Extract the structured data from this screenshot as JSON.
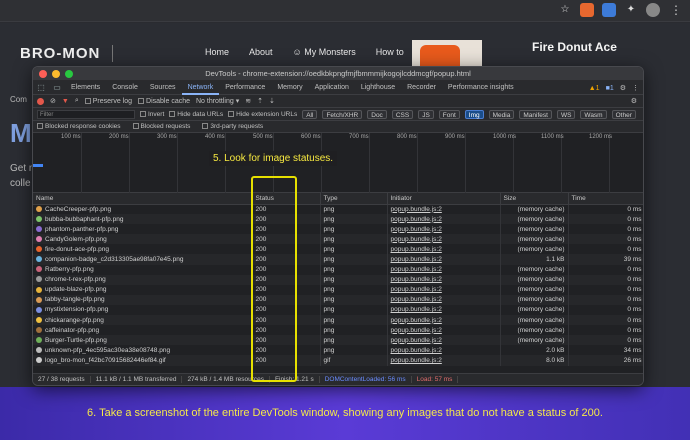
{
  "site": {
    "logo": "BRO-MON",
    "nav": [
      "Home",
      "About",
      "My Monsters",
      "How to"
    ],
    "side_lines": [
      "Com",
      "M",
      "Get r",
      "colle"
    ],
    "card_title": "Fire Donut Ace"
  },
  "devtools": {
    "title": "DevTools - chrome-extension://oedkbkpngfmjfbmmmijkogojlcddmcgf/popup.html",
    "tabs": [
      "Elements",
      "Console",
      "Sources",
      "Network",
      "Performance",
      "Memory",
      "Application",
      "Lighthouse",
      "Recorder",
      "Performance insights"
    ],
    "active_tab": "Network",
    "warn_count": "1",
    "err_count": "1",
    "toolbar": {
      "preserve_log": "Preserve log",
      "disable_cache": "Disable cache",
      "throttling": "No throttling"
    },
    "filter": {
      "placeholder": "Filter",
      "invert": "Invert",
      "hide_data_urls": "Hide data URLs",
      "hide_ext_urls": "Hide extension URLs",
      "chips": [
        "All",
        "Fetch/XHR",
        "Doc",
        "CSS",
        "JS",
        "Font",
        "Img",
        "Media",
        "Manifest",
        "WS",
        "Wasm",
        "Other"
      ],
      "active_chip": "Img"
    },
    "blocked": {
      "cookies": "Blocked response cookies",
      "requests": "Blocked requests",
      "third_party": "3rd-party requests"
    },
    "timeline_ticks": [
      "100 ms",
      "200 ms",
      "300 ms",
      "400 ms",
      "500 ms",
      "600 ms",
      "700 ms",
      "800 ms",
      "900 ms",
      "1000 ms",
      "1100 ms",
      "1200 ms"
    ],
    "columns": [
      "Name",
      "Status",
      "Type",
      "Initiator",
      "Size",
      "Time"
    ],
    "rows": [
      {
        "name": "CacheCreeper-pfp.png",
        "status": "200",
        "type": "png",
        "initiator": "popup.bundle.js:2",
        "size": "(memory cache)",
        "time": "0 ms",
        "color": "#e0a14b"
      },
      {
        "name": "bubba-bubbaphant-pfp.png",
        "status": "200",
        "type": "png",
        "initiator": "popup.bundle.js:2",
        "size": "(memory cache)",
        "time": "0 ms",
        "color": "#7cc46a"
      },
      {
        "name": "phantom-panther-pfp.png",
        "status": "200",
        "type": "png",
        "initiator": "popup.bundle.js:2",
        "size": "(memory cache)",
        "time": "0 ms",
        "color": "#8a6bd1"
      },
      {
        "name": "CandyGolem-pfp.png",
        "status": "200",
        "type": "png",
        "initiator": "popup.bundle.js:2",
        "size": "(memory cache)",
        "time": "0 ms",
        "color": "#e07fb0"
      },
      {
        "name": "fire-donut-ace-pfp.png",
        "status": "200",
        "type": "png",
        "initiator": "popup.bundle.js:2",
        "size": "(memory cache)",
        "time": "0 ms",
        "color": "#e8642c"
      },
      {
        "name": "companion-badge_c2d313305ae98fa07e45.png",
        "status": "200",
        "type": "png",
        "initiator": "popup.bundle.js:2",
        "size": "1.1 kB",
        "time": "39 ms",
        "color": "#6ab4e0"
      },
      {
        "name": "Ratberry-pfp.png",
        "status": "200",
        "type": "png",
        "initiator": "popup.bundle.js:2",
        "size": "(memory cache)",
        "time": "0 ms",
        "color": "#c9637a"
      },
      {
        "name": "chrome-t-rex-pfp.png",
        "status": "200",
        "type": "png",
        "initiator": "popup.bundle.js:2",
        "size": "(memory cache)",
        "time": "0 ms",
        "color": "#9a9a9a"
      },
      {
        "name": "update-blaze-pfp.png",
        "status": "200",
        "type": "png",
        "initiator": "popup.bundle.js:2",
        "size": "(memory cache)",
        "time": "0 ms",
        "color": "#e6b23a"
      },
      {
        "name": "tabby-tangle-pfp.png",
        "status": "200",
        "type": "png",
        "initiator": "popup.bundle.js:2",
        "size": "(memory cache)",
        "time": "0 ms",
        "color": "#d89a55"
      },
      {
        "name": "mystixtension-pfp.png",
        "status": "200",
        "type": "png",
        "initiator": "popup.bundle.js:2",
        "size": "(memory cache)",
        "time": "0 ms",
        "color": "#7a8ee0"
      },
      {
        "name": "chickarange-pfp.png",
        "status": "200",
        "type": "png",
        "initiator": "popup.bundle.js:2",
        "size": "(memory cache)",
        "time": "0 ms",
        "color": "#f0c040"
      },
      {
        "name": "caffeinator-pfp.png",
        "status": "200",
        "type": "png",
        "initiator": "popup.bundle.js:2",
        "size": "(memory cache)",
        "time": "0 ms",
        "color": "#a0703c"
      },
      {
        "name": "Burger-Turtle-pfp.png",
        "status": "200",
        "type": "png",
        "initiator": "popup.bundle.js:2",
        "size": "(memory cache)",
        "time": "0 ms",
        "color": "#6fb05a"
      },
      {
        "name": "unknown-pfp_4ec595ac30ea38e08748.png",
        "status": "200",
        "type": "png",
        "initiator": "popup.bundle.js:2",
        "size": "2.0 kB",
        "time": "34 ms",
        "color": "#bbbbbb"
      },
      {
        "name": "logo_bro-mon_f42bc70915682446ef84.gif",
        "status": "200",
        "type": "gif",
        "initiator": "popup.bundle.js:2",
        "size": "8.0 kB",
        "time": "26 ms",
        "color": "#cccccc"
      }
    ],
    "cached_status_rows": [
      0,
      1,
      2,
      3,
      4,
      6,
      7,
      8,
      9,
      10,
      11,
      12,
      13
    ],
    "statusbar": {
      "requests": "27 / 38 requests",
      "transferred": "11.1 kB / 1.1 MB transferred",
      "resources": "274 kB / 1.4 MB resources",
      "finish": "Finish: 1.21 s",
      "dcl": "DOMContentLoaded: 56 ms",
      "load": "Load: 57 ms"
    }
  },
  "annotations": {
    "callout": "5. Look for image statuses.",
    "banner": "6. Take a screenshot of the entire DevTools window, showing any images that do not have a status of 200."
  },
  "colors": {
    "accent": "#8ab4f8",
    "highlight": "#e6e000",
    "banner_text": "#f5e84a"
  }
}
